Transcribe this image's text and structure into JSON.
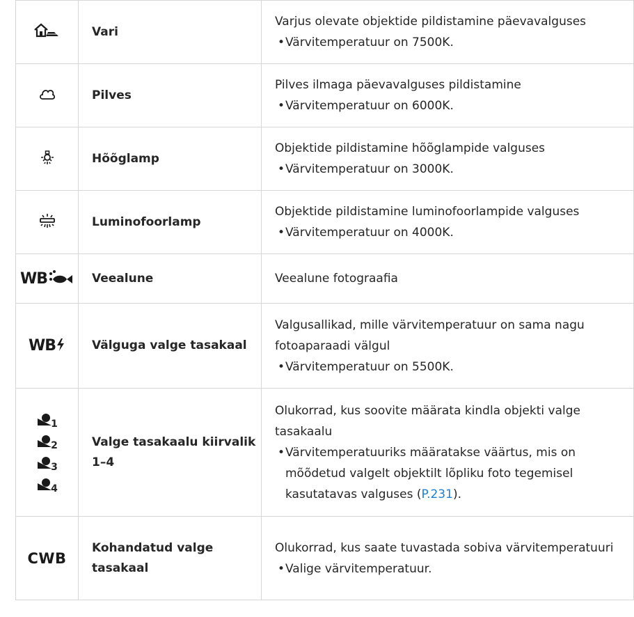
{
  "rows": [
    {
      "icon": "shade-icon",
      "name": "Vari",
      "desc": "Varjus olevate objektide pildistamine päevavalguses",
      "bullet": "Värvitemperatuur on 7500K."
    },
    {
      "icon": "cloudy-icon",
      "name": "Pilves",
      "desc": "Pilves ilmaga päevavalguses pildistamine",
      "bullet": "Värvitemperatuur on 6000K."
    },
    {
      "icon": "incandescent-icon",
      "name": "Hõõglamp",
      "desc": "Objektide pildistamine hõõglampide valguses",
      "bullet": "Värvitemperatuur on 3000K."
    },
    {
      "icon": "fluorescent-icon",
      "name": "Luminofoorlamp",
      "desc": "Objektide pildistamine luminofoorlampide valguses",
      "bullet": "Värvitemperatuur on 4000K."
    },
    {
      "icon": "wb-underwater-icon",
      "icon_text": "WB",
      "name": "Veealune",
      "desc": "Veealune fotograafia"
    },
    {
      "icon": "wb-flash-icon",
      "icon_text": "WB",
      "name": "Välguga valge tasakaal",
      "desc": "Valgusallikad, mille värvitemperatuur on sama nagu fotoaparaadi välgul",
      "bullet": "Värvitemperatuur on 5500K."
    },
    {
      "icon": "one-touch-wb-icon",
      "icon_numbers": [
        "1",
        "2",
        "3",
        "4"
      ],
      "name": "Valge tasakaalu kiirvalik 1–4",
      "desc": "Olukorrad, kus soovite määrata kindla objekti valge tasakaalu",
      "bullet": "Värvitemperatuuriks määratakse väärtus, mis on mõõdetud valgelt objektilt lõpliku foto tegemisel kasutatavas valguses (",
      "bullet_link": "P.231",
      "bullet_end": ")."
    },
    {
      "icon": "custom-wb-icon",
      "icon_text": "CWB",
      "name": "Kohandatud valge tasakaal",
      "desc": "Olukorrad, kus saate tuvastada sobiva värvitemperatuuri",
      "bullet": "Valige värvitemperatuur."
    }
  ],
  "colors": {
    "link": "#1f7fd0",
    "border": "#d6d6d6",
    "text": "#262626"
  }
}
